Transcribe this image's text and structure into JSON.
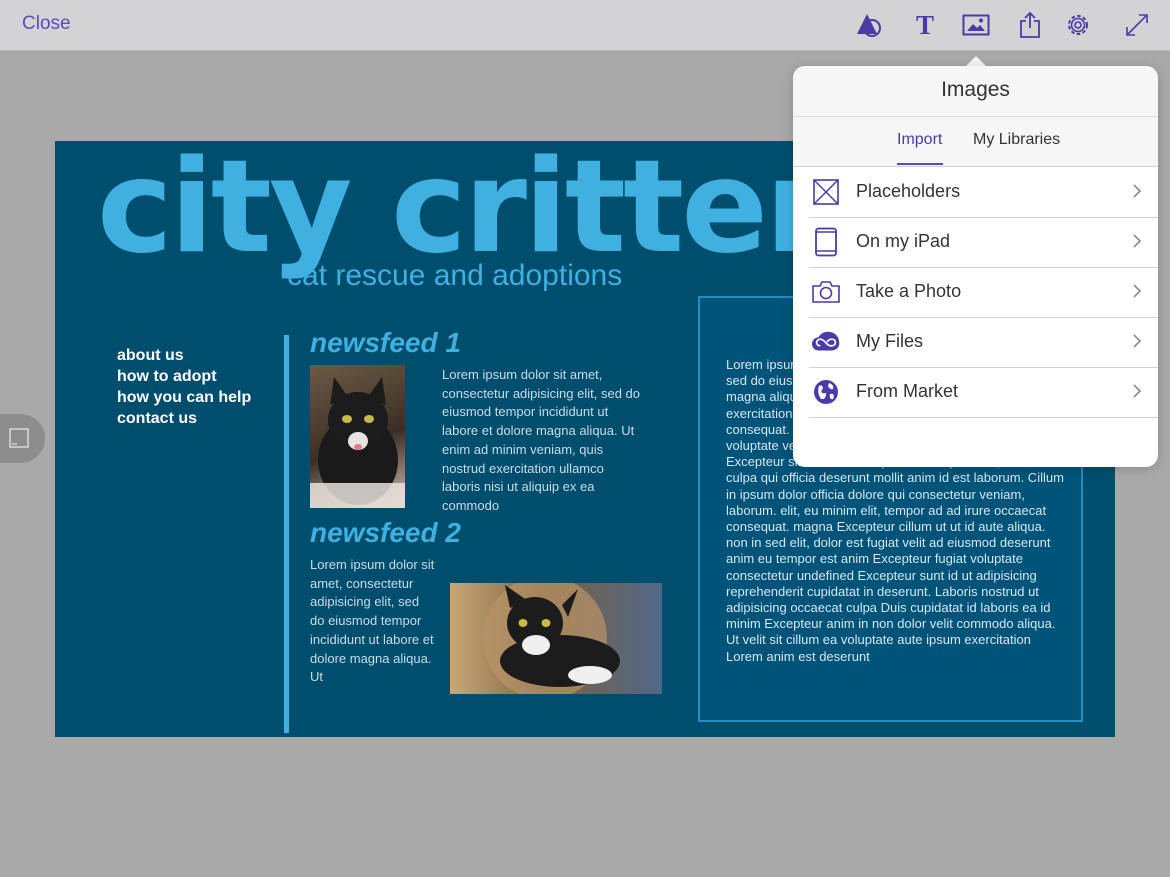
{
  "toolbar": {
    "close_label": "Close",
    "icons": [
      "shapes-icon",
      "text-icon",
      "image-icon",
      "share-icon",
      "settings-icon",
      "fullscreen-icon"
    ],
    "accent_color": "#5a4ac0"
  },
  "document": {
    "title": "city critters.",
    "subtitle": "cat rescue and adoptions",
    "nav": [
      "about us",
      "how to adopt",
      "how you can help",
      "contact us"
    ],
    "newsfeed1": {
      "heading": "newsfeed 1",
      "body": "Lorem ipsum dolor sit amet, consectetur adipisicing elit, sed do eiusmod tempor incididunt ut labore et dolore magna aliqua. Ut enim ad minim veniam, quis nostrud exercitation ullamco laboris nisi ut aliquip ex ea commodo"
    },
    "newsfeed2": {
      "heading": "newsfeed 2",
      "body": "Lorem ipsum dolor sit amet, consectetur adipisicing elit, sed do eiusmod tempor incididunt ut labore et dolore magna aliqua. Ut"
    },
    "panel_text": "Lorem ipsum dolor sit amet, consectetur adipisicing elit, sed do eiusmod tempor incididunt ut labore et dolore magna aliqua. Ut enim ad minim veniam, quis nostrud exercitation ullamco laboris nisi ut aliquip ex ea commodo consequat. Duis aute irure dolor in reprehenderit in voluptate velit esse cillum dolore eu fugiat nulla pariatur. Excepteur sint occaecat cupidatat non proident, sunt in culpa qui officia deserunt mollit anim id est laborum. Cillum in ipsum dolor officia dolore qui consectetur veniam, laborum. elit, eu minim elit, tempor ad ad irure occaecat consequat. magna Excepteur cillum ut ut id aute aliqua. non in sed elit, dolor est fugiat velit ad eiusmod deserunt anim eu tempor est anim Excepteur fugiat voluptate consectetur undefined Excepteur sunt id ut adipisicing reprehenderit cupidatat in deserunt. Laboris nostrud ut adipisicing occaecat culpa Duis cupidatat id laboris ea id minim Excepteur anim in non dolor velit commodo aliqua. Ut velit sit cillum ea voluptate aute ipsum exercitation Lorem anim est deserunt",
    "colors": {
      "background": "#004e6e",
      "accent": "#3fb0e0"
    }
  },
  "popover": {
    "title": "Images",
    "tabs": [
      "Import",
      "My Libraries"
    ],
    "active_tab": "Import",
    "items": [
      {
        "label": "Placeholders",
        "icon": "placeholder-icon"
      },
      {
        "label": "On my iPad",
        "icon": "ipad-icon"
      },
      {
        "label": "Take a Photo",
        "icon": "camera-icon"
      },
      {
        "label": "My Files",
        "icon": "creative-cloud-icon"
      },
      {
        "label": "From Market",
        "icon": "globe-icon"
      }
    ]
  }
}
